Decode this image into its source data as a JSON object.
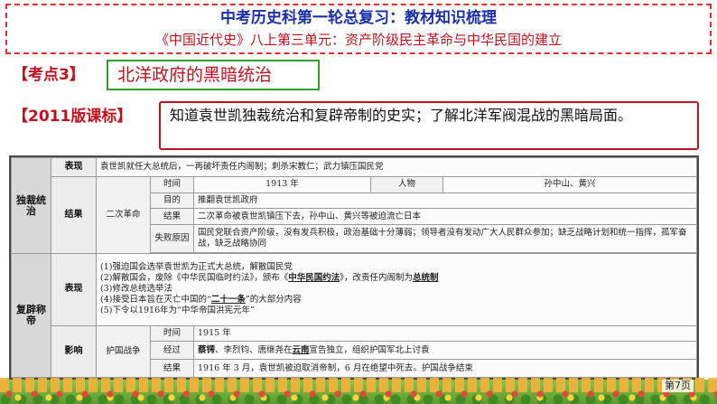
{
  "header": {
    "line1": "中考历史科第一轮总复习：教材知识梳理",
    "line2": "《中国近代史》八上第三单元：资产阶级民主革命与中华民国的建立"
  },
  "kaodian": {
    "label": "【考点3】",
    "title": "北洋政府的黑暗统治"
  },
  "kebiao": {
    "label": "【2011版课标】",
    "text": "知道袁世凯独裁统治和复辟帝制的史实；了解北洋军阀混战的黑暗局面。"
  },
  "table": {
    "dictatorship": {
      "category": "独裁统治",
      "biaoxian_label": "表现",
      "biaoxian_text": "袁世凯就任大总统后，一再破坏责任内阁制；刺杀宋教仁；武力镇压国民党",
      "jieguo_label": "结果",
      "revolution_label": "二次革命",
      "rows": {
        "time_label": "时间",
        "time_value": "1913 年",
        "person_label": "人物",
        "person_value": "孙中山、黄兴",
        "purpose_label": "目的",
        "purpose_value": "推翻袁世凯政府",
        "result_label": "结果",
        "result_value": "二次革命被袁世凯镇压下去，孙中山、黄兴等被迫流亡日本",
        "failure_label": "失败原因",
        "failure_value": "国民党联合资产阶级，没有发兵积极，政治基础十分薄弱；领导者没有发动广大人民群众参加；缺乏战略计划和统一指挥，孤军奋战，缺乏战略协同"
      }
    },
    "restoration": {
      "category": "复辟称帝",
      "biaoxian_label": "表现",
      "items": {
        "i1": "(1)强迫国会选举袁世凯为正式大总统，解散国民党",
        "i2_pre": "(2)解散国会，废除《中华民国临时约法》，颁布《",
        "i2_bold": "中华民国约法",
        "i2_mid": "》，改责任内阁制为",
        "i2_bold2": "总统制",
        "i3": "(3)修改总统选举法",
        "i4": "(4)接受日本旨在灭亡中国的“二十一条”的大部分内容",
        "i4_pre": "(4)接受日本旨在灭亡中国的“",
        "i4_bold": "二十一条",
        "i4_post": "”的大部分内容",
        "i5": "(5)下令以1916年为“中华帝国洪宪元年”"
      },
      "yingxiang_label": "影响",
      "war_label": "护国战争",
      "rows": {
        "time_label": "时间",
        "time_value": "1915 年",
        "process_label": "经过",
        "process_bold1": "蔡锷",
        "process_mid": "、李烈钧、唐继尧在",
        "process_bold2": "云南",
        "process_post": "宣告独立，组织护国军北上讨袁",
        "result_label": "结果",
        "result_value": "1916 年 3 月，袁世凯被迫取消帝制，6 月在绝望中死去。护国战争结束"
      }
    }
  },
  "footer": {
    "page_number": "第7页"
  }
}
